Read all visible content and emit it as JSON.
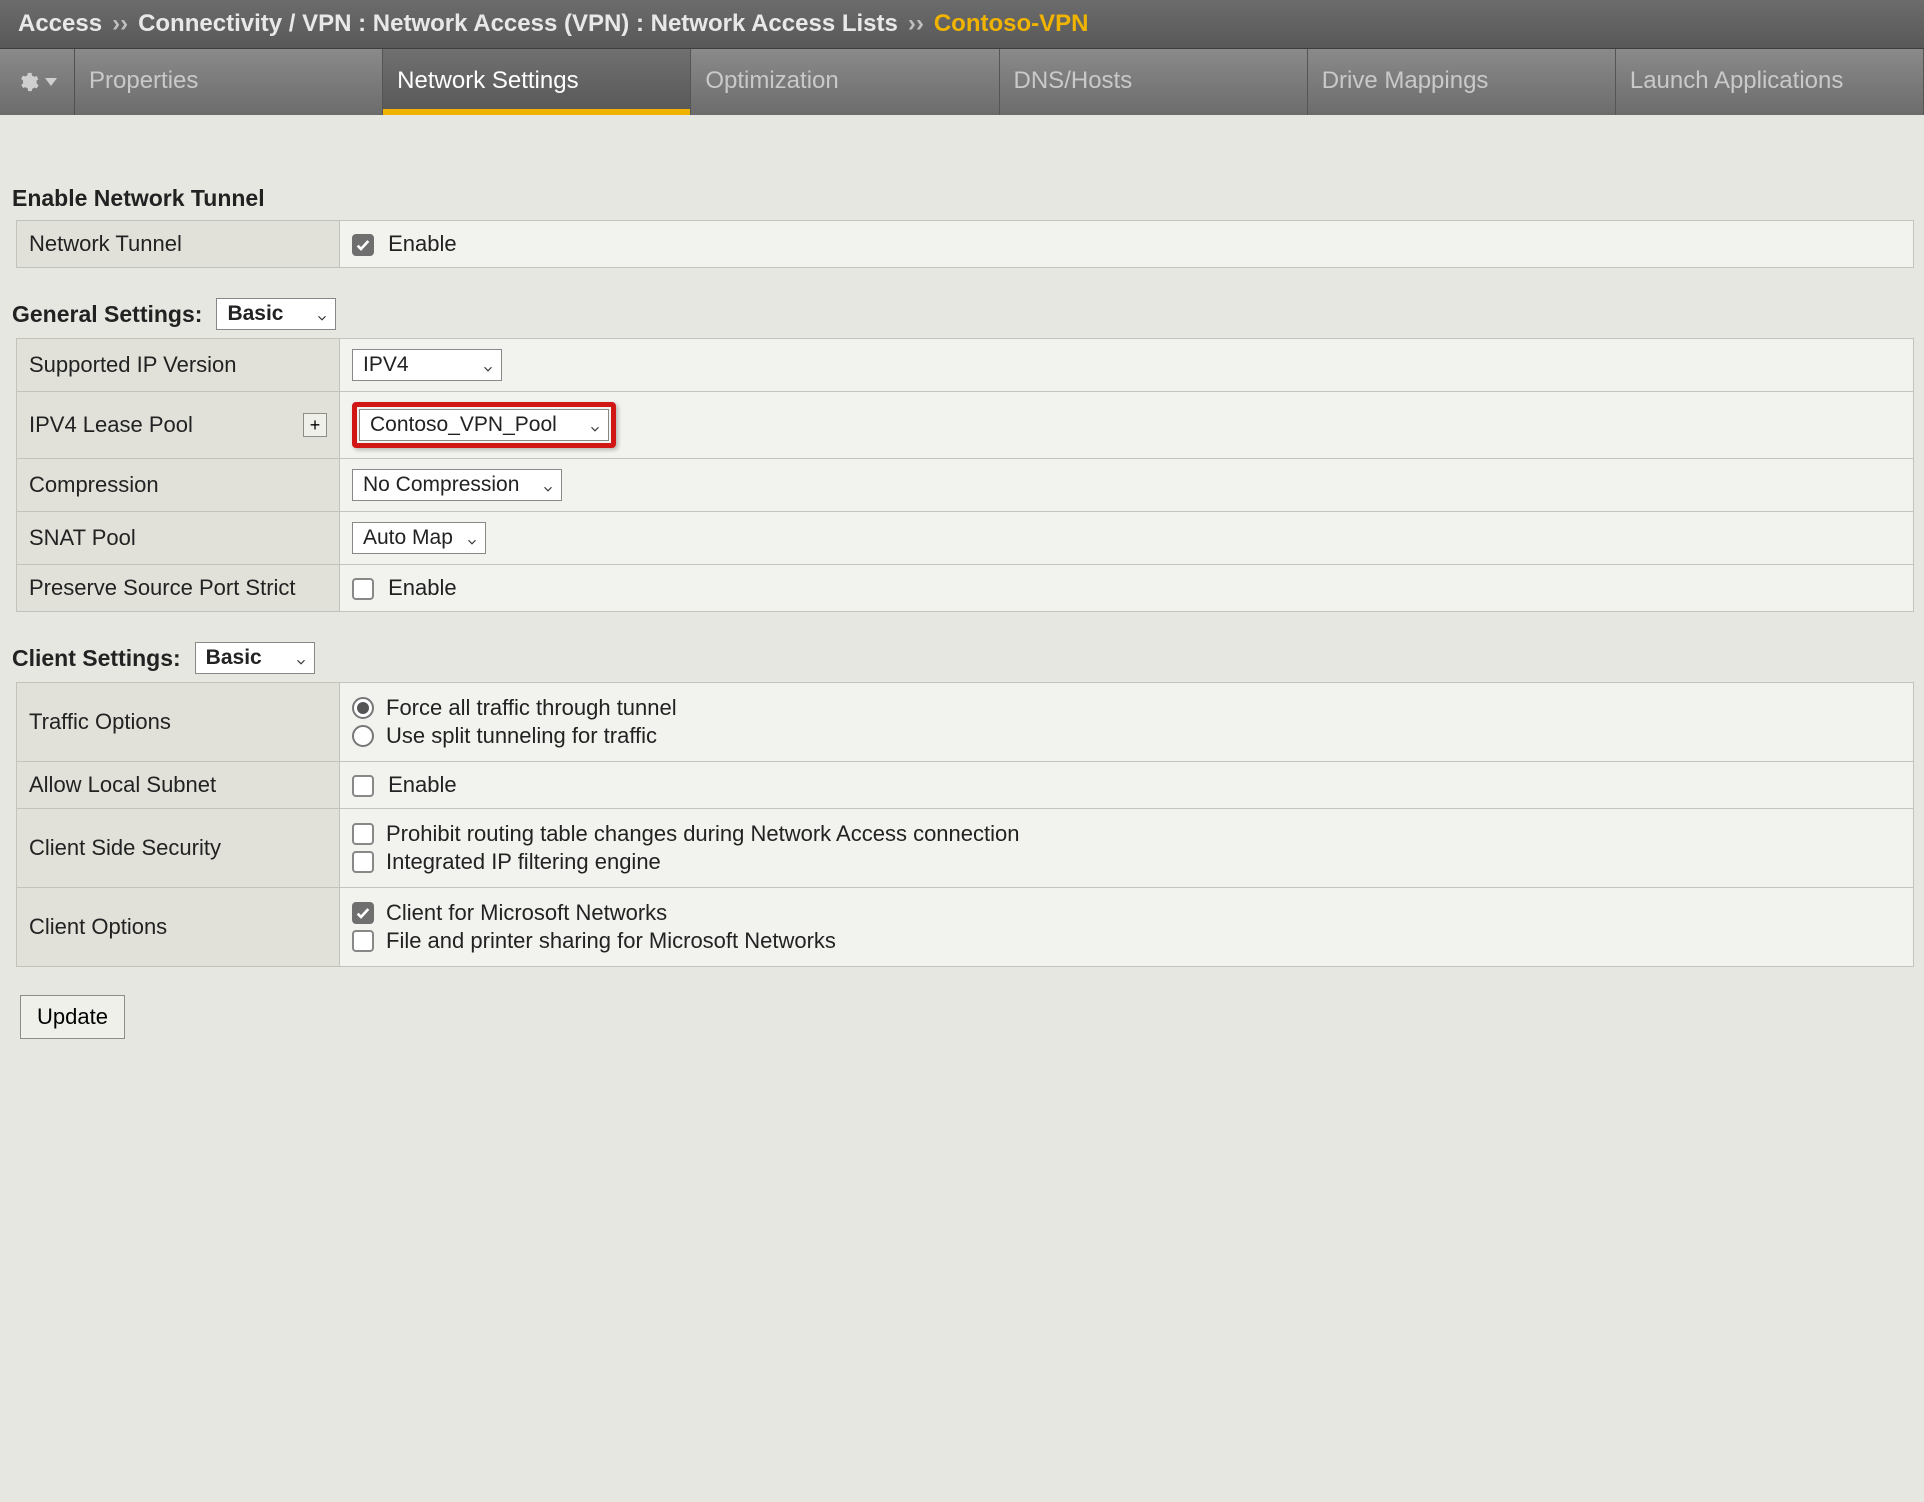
{
  "breadcrumb": {
    "root": "Access",
    "sep": "››",
    "path": "Connectivity / VPN : Network Access (VPN) : Network Access Lists",
    "leaf": "Contoso-VPN"
  },
  "tabs": [
    {
      "id": "properties",
      "label": "Properties",
      "active": false
    },
    {
      "id": "network-settings",
      "label": "Network Settings",
      "active": true
    },
    {
      "id": "optimization",
      "label": "Optimization",
      "active": false
    },
    {
      "id": "dns-hosts",
      "label": "DNS/Hosts",
      "active": false
    },
    {
      "id": "drive-mappings",
      "label": "Drive Mappings",
      "active": false
    },
    {
      "id": "launch-applications",
      "label": "Launch Applications",
      "active": false
    }
  ],
  "sections": {
    "enable_tunnel": {
      "title": "Enable Network Tunnel",
      "rows": {
        "network_tunnel": {
          "label": "Network Tunnel",
          "checkbox_label": "Enable",
          "checked": true
        }
      }
    },
    "general": {
      "title": "General Settings:",
      "mode_select": "Basic",
      "rows": {
        "ip_version": {
          "label": "Supported IP Version",
          "value": "IPV4"
        },
        "lease_pool": {
          "label": "IPV4 Lease Pool",
          "value": "Contoso_VPN_Pool",
          "add_btn": "+"
        },
        "compression": {
          "label": "Compression",
          "value": "No Compression"
        },
        "snat": {
          "label": "SNAT Pool",
          "value": "Auto Map"
        },
        "preserve_port": {
          "label": "Preserve Source Port Strict",
          "checkbox_label": "Enable",
          "checked": false
        }
      }
    },
    "client": {
      "title": "Client Settings:",
      "mode_select": "Basic",
      "rows": {
        "traffic": {
          "label": "Traffic Options",
          "options": [
            {
              "label": "Force all traffic through tunnel",
              "checked": true
            },
            {
              "label": "Use split tunneling for traffic",
              "checked": false
            }
          ]
        },
        "allow_local": {
          "label": "Allow Local Subnet",
          "checkbox_label": "Enable",
          "checked": false
        },
        "side_security": {
          "label": "Client Side Security",
          "checks": [
            {
              "label": "Prohibit routing table changes during Network Access connection",
              "checked": false
            },
            {
              "label": "Integrated IP filtering engine",
              "checked": false
            }
          ]
        },
        "client_options": {
          "label": "Client Options",
          "checks": [
            {
              "label": "Client for Microsoft Networks",
              "checked": true
            },
            {
              "label": "File and printer sharing for Microsoft Networks",
              "checked": false
            }
          ]
        }
      }
    }
  },
  "buttons": {
    "update": "Update"
  }
}
